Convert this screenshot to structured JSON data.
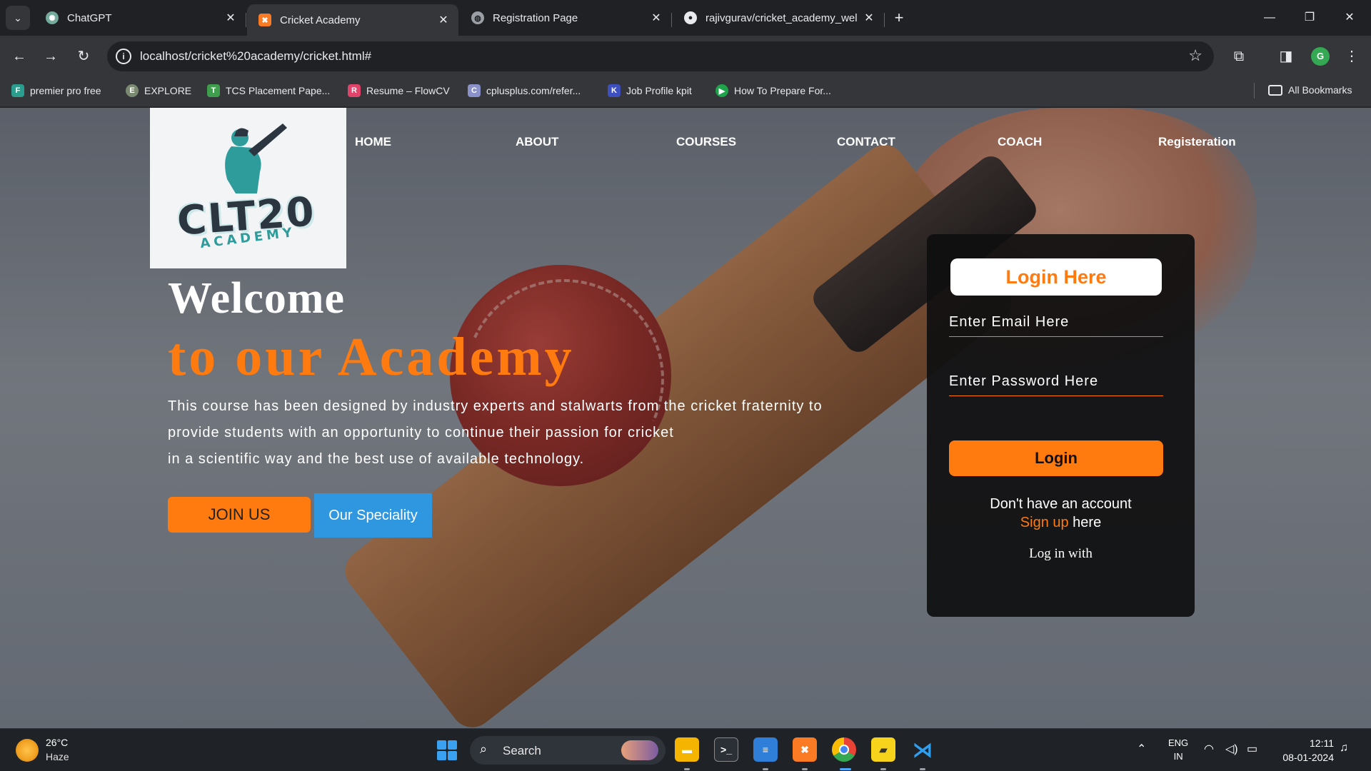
{
  "browser": {
    "tabs": [
      {
        "title": "ChatGPT",
        "active": false,
        "icon": "chatgpt-icon"
      },
      {
        "title": "Cricket Academy",
        "active": true,
        "icon": "xampp-icon"
      },
      {
        "title": "Registration Page",
        "active": false,
        "icon": "globe-icon"
      },
      {
        "title": "rajivgurav/cricket_academy_wel",
        "active": false,
        "icon": "github-icon"
      }
    ],
    "url": "localhost/cricket%20academy/cricket.html#",
    "profile_initial": "G",
    "bookmarks": [
      {
        "label": "premier pro free",
        "icon": "frame-icon"
      },
      {
        "label": "EXPLORE",
        "icon": "explore-icon"
      },
      {
        "label": "TCS Placement Pape...",
        "icon": "tcs-icon"
      },
      {
        "label": "Resume – FlowCV",
        "icon": "flowcv-icon"
      },
      {
        "label": "cplusplus.com/refer...",
        "icon": "cplusplus-icon"
      },
      {
        "label": "Job Profile kpit",
        "icon": "kpit-icon"
      },
      {
        "label": "How To Prepare For...",
        "icon": "prepare-icon"
      }
    ],
    "all_bookmarks": "All Bookmarks"
  },
  "site": {
    "logo": {
      "text": "CLT20",
      "sub": "ACADEMY"
    },
    "nav": [
      "HOME",
      "ABOUT",
      "COURSES",
      "CONTACT",
      "COACH",
      "Registeration"
    ],
    "hero": {
      "welcome": "Welcome",
      "academy": "to our Academy",
      "desc_lines": [
        "This course has been designed by industry experts and stalwarts from the cricket fraternity to",
        "provide students with an opportunity to continue their passion for cricket",
        "in a scientific way and the best use of available technology."
      ],
      "join": "JOIN US",
      "speciality": "Our Speciality"
    },
    "login": {
      "title": "Login Here",
      "email_placeholder": "Enter Email Here",
      "password_placeholder": "Enter Password Here",
      "button": "Login",
      "no_account": "Don't have an account",
      "sign_up": "Sign up",
      "here": " here",
      "log_in_with": "Log in with"
    },
    "colors": {
      "accent": "#ff7a0f",
      "speciality_blue": "#2f96e0"
    }
  },
  "taskbar": {
    "weather": {
      "temp": "26°C",
      "condition": "Haze"
    },
    "search": "Search",
    "lang": [
      "ENG",
      "IN"
    ],
    "time": "12:11",
    "date": "08-01-2024"
  }
}
